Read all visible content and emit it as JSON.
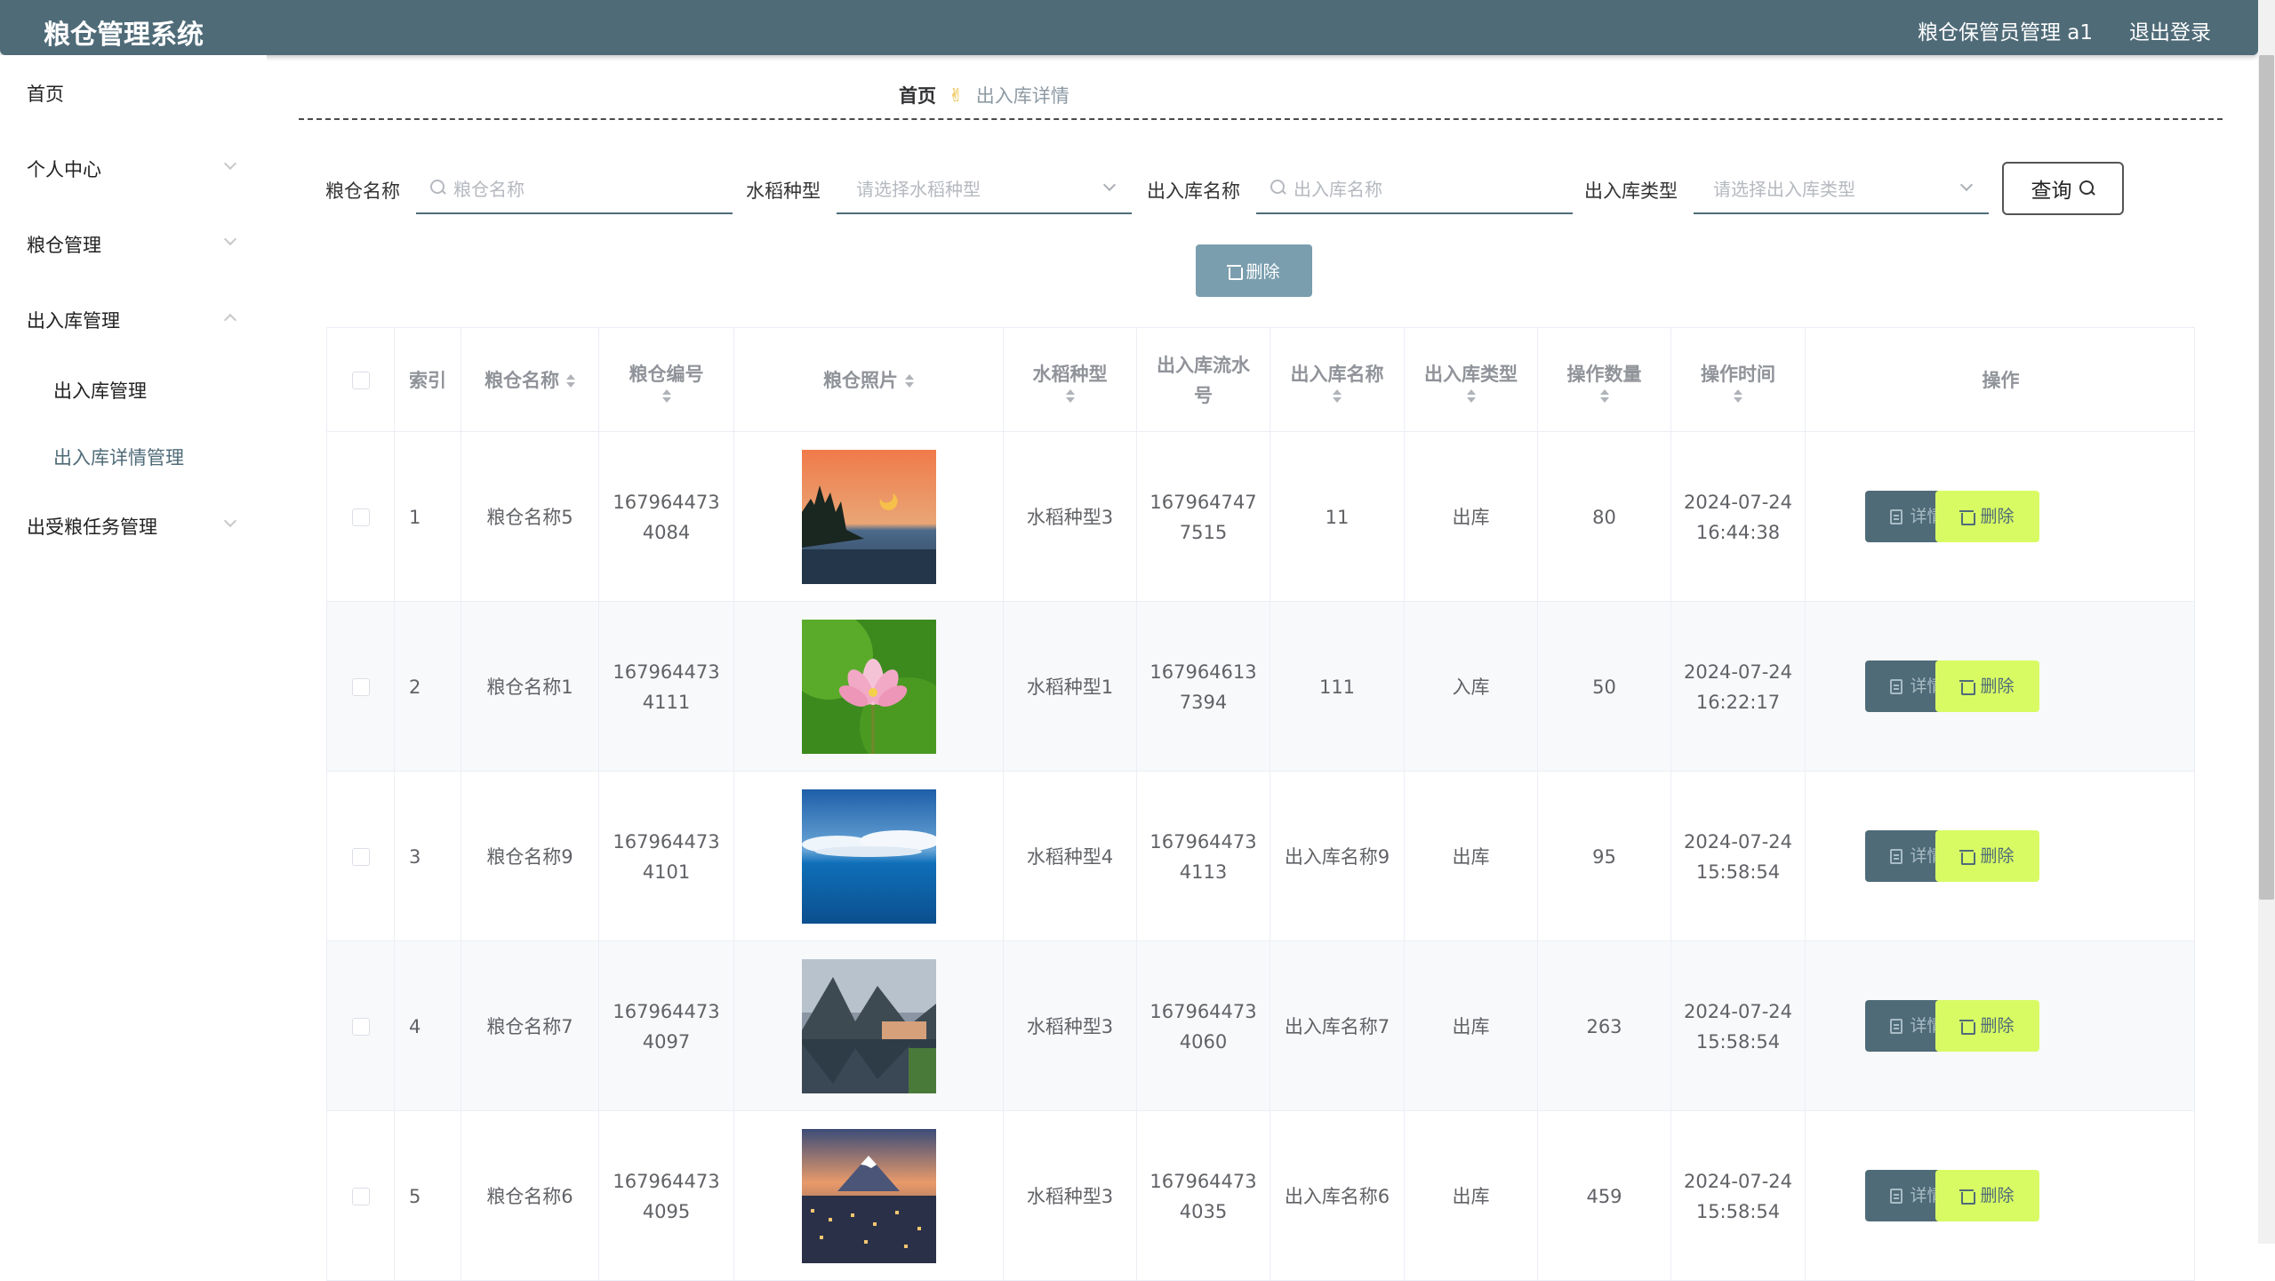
{
  "header": {
    "title": "粮仓管理系统",
    "user": "粮仓保管员管理 a1",
    "logout": "退出登录"
  },
  "sidebar": {
    "items": [
      {
        "label": "首页"
      },
      {
        "label": "个人中心"
      },
      {
        "label": "粮仓管理"
      },
      {
        "label": "出入库管理"
      },
      {
        "label": "出入库管理"
      },
      {
        "label": "出入库详情管理"
      },
      {
        "label": "出受粮任务管理"
      }
    ]
  },
  "breadcrumb": {
    "home": "首页",
    "separator": "✌",
    "current": "出入库详情"
  },
  "search": {
    "fields": [
      {
        "label": "粮仓名称",
        "placeholder": "粮仓名称",
        "icon": "search-icon"
      },
      {
        "label": "水稻种型",
        "placeholder": "请选择水稻种型",
        "icon": "chevron-down-icon"
      },
      {
        "label": "出入库名称",
        "placeholder": "出入库名称",
        "icon": "search-icon"
      },
      {
        "label": "出入库类型",
        "placeholder": "请选择出入库类型",
        "icon": "chevron-down-icon"
      }
    ],
    "query_button": "查询"
  },
  "toolbar": {
    "delete_label": "删除"
  },
  "table": {
    "columns": [
      "索引",
      "粮仓名称",
      "粮仓编号",
      "粮仓照片",
      "水稻种型",
      "出入库流水号",
      "出入库名称",
      "出入库类型",
      "操作数量",
      "操作时间",
      "操作"
    ],
    "rows": [
      {
        "index": "1",
        "name": "粮仓名称5",
        "code_1": "167964473",
        "code_2": "4084",
        "photo": "sunset-lake-landscape",
        "rice": "水稻种型3",
        "serial_1": "167964747",
        "serial_2": "7515",
        "io_name": "11",
        "io_type": "出库",
        "qty": "80",
        "date": "2024-07-24",
        "time": "16:44:38"
      },
      {
        "index": "2",
        "name": "粮仓名称1",
        "code_1": "167964473",
        "code_2": "4111",
        "photo": "lotus-flower",
        "rice": "水稻种型1",
        "serial_1": "167964613",
        "serial_2": "7394",
        "io_name": "111",
        "io_type": "入库",
        "qty": "50",
        "date": "2024-07-24",
        "time": "16:22:17"
      },
      {
        "index": "3",
        "name": "粮仓名称9",
        "code_1": "167964473",
        "code_2": "4101",
        "photo": "blue-sea-sky",
        "rice": "水稻种型4",
        "serial_1": "167964473",
        "serial_2": "4113",
        "io_name": "出入库名称9",
        "io_type": "出库",
        "qty": "95",
        "date": "2024-07-24",
        "time": "15:58:54"
      },
      {
        "index": "4",
        "name": "粮仓名称7",
        "code_1": "167964473",
        "code_2": "4097",
        "photo": "mountain-village-lake",
        "rice": "水稻种型3",
        "serial_1": "167964473",
        "serial_2": "4060",
        "io_name": "出入库名称7",
        "io_type": "出库",
        "qty": "263",
        "date": "2024-07-24",
        "time": "15:58:54"
      },
      {
        "index": "5",
        "name": "粮仓名称6",
        "code_1": "167964473",
        "code_2": "4095",
        "photo": "mount-fuji-city",
        "rice": "水稻种型3",
        "serial_1": "167964473",
        "serial_2": "4035",
        "io_name": "出入库名称6",
        "io_type": "出库",
        "qty": "459",
        "date": "2024-07-24",
        "time": "15:58:54"
      }
    ],
    "detail_label": "详情",
    "delete_label": "删除"
  },
  "colors": {
    "primary": "#4f6b78",
    "accent_delete": "#d8fb64",
    "bulk_delete": "#7a9eae",
    "stripe": "#f8f9fb"
  }
}
